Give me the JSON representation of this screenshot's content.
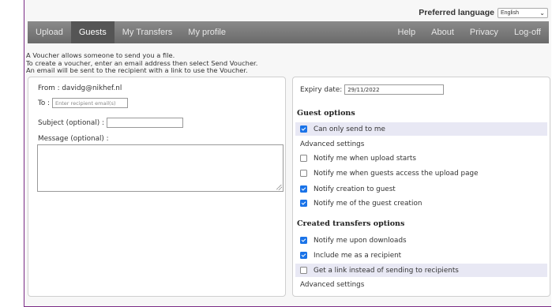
{
  "header": {
    "preferred_language_label": "Preferred language",
    "language_value": "English"
  },
  "nav": {
    "upload": "Upload",
    "guests": "Guests",
    "my_transfers": "My Transfers",
    "my_profile": "My profile",
    "help": "Help",
    "about": "About",
    "privacy": "Privacy",
    "logoff": "Log-off"
  },
  "intro": {
    "line1": "A Voucher allows someone to send you a file.",
    "line2": "To create a voucher, enter an email address then select Send Voucher.",
    "line3": "An email will be sent to the recipient with a link to use the Voucher."
  },
  "form": {
    "from_label": "From : davidg@nikhef.nl",
    "to_label": "To :",
    "to_placeholder": "Enter recipient email(s)",
    "subject_label": "Subject (optional) :",
    "subject_value": "",
    "message_label": "Message (optional) :"
  },
  "options": {
    "expiry_label": "Expiry date:",
    "expiry_value": "29/11/2022",
    "guest_options_title": "Guest options",
    "can_only_send_to_me": "Can only send to me",
    "advanced_settings_1": "Advanced settings",
    "notify_upload_starts": "Notify me when upload starts",
    "notify_guests_access": "Notify me when guests access the upload page",
    "notify_creation_to_guest": "Notify creation to guest",
    "notify_guest_creation": "Notify me of the guest creation",
    "created_transfers_title": "Created transfers options",
    "notify_downloads": "Notify me upon downloads",
    "include_me": "Include me as a recipient",
    "get_link": "Get a link instead of sending to recipients",
    "advanced_settings_2": "Advanced settings"
  },
  "checkbox_states": {
    "can_only_send_to_me": true,
    "notify_upload_starts": false,
    "notify_guests_access": false,
    "notify_creation_to_guest": true,
    "notify_guest_creation": true,
    "notify_downloads": true,
    "include_me": true,
    "get_link": false
  },
  "colors": {
    "accent_border": "#7b2c86",
    "checkbox_blue": "#1a73e8",
    "nav_active": "#555555",
    "highlight_row": "#e8e8f4"
  }
}
